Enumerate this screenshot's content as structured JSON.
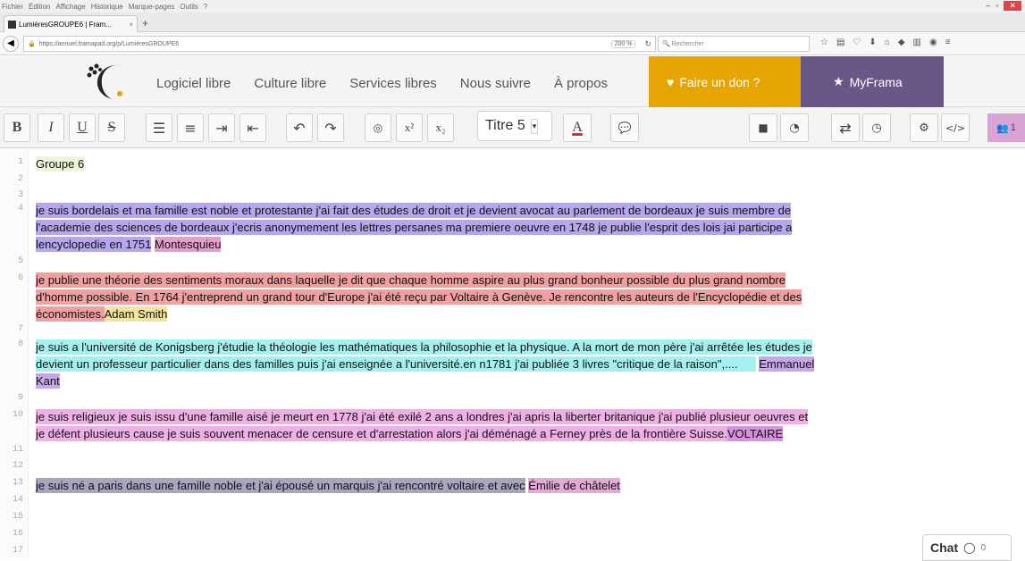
{
  "menubar": {
    "items": [
      "Fichier",
      "Édition",
      "Affichage",
      "Historique",
      "Marque-pages",
      "Outils",
      "?"
    ]
  },
  "tab": {
    "title": "LumièresGROUPE6 | Fram...",
    "close": "×",
    "new": "+"
  },
  "url": {
    "value": "https://annuel.framapad.org/p/LumièresGROUPE6",
    "zoom": "200 %",
    "search_placeholder": "Rechercher"
  },
  "nav": {
    "links": [
      "Logiciel libre",
      "Culture libre",
      "Services libres",
      "Nous suivre",
      "À propos"
    ],
    "don": "Faire un don ?",
    "myframa": "MyFrama"
  },
  "toolbar": {
    "bold": "B",
    "italic": "I",
    "underline": "U",
    "strike": "S",
    "heading": "Titre 5",
    "sup": "x²",
    "sub": "x₂",
    "users_count": "1"
  },
  "colors": {
    "don": "#e6a500",
    "myframa": "#6a5687"
  },
  "doc": {
    "line1": "Groupe 6",
    "p2a": "je suis bordelais et ma famille est noble et protestante j'ai fait des études de droit et je devient avocat au parlement de bordeaux je suis membre de",
    "p2b": "l'academie des sciences de bordeaux j'ecris anonymement les lettres persanes ma premiere oeuvre en 1748 je publie l'esprit des lois jai participe a",
    "p2c": "lencyclopedie en 1751",
    "p2name": "Montesquieu",
    "p3a": "je publie une théorie des sentiments moraux dans laquelle je dit que chaque homme aspire au plus grand bonheur possible du plus grand nombre",
    "p3b": "d'homme possible. En 1764 j'entreprend un grand tour d'Europe j'ai été reçu par Voltaire à Genève. Je rencontre les auteurs de l'Encyclopédie et des",
    "p3c": "économistes.",
    "p3name": "Adam Smith",
    "p4a": "je suis a l'université de Konigsberg j'étudie la théologie les mathématiques la philosophie et la physique. A la mort de mon père j'ai arrêtée les études je",
    "p4b": "devient un professeur particulier dans des familles puis j'ai enseignée a l'université.en n1781 j'ai publiée 3 livres \"critique de la raison\",....",
    "p4name1": "Emmanuel",
    "p4name2": "Kant",
    "p5a": "je suis religieux je suis issu d'une famille aisé je meurt en 1778 j'ai été exilé 2 ans a londres j'ai apris la liberter britanique j'ai publié plusieur oeuvres et",
    "p5b": "je défent plusieurs cause je suis souvent menacer de censure et d'arrestation alors j'ai déménagé a Ferney près de la frontière Suisse.",
    "p5name": "VOLTAIRE",
    "p6a": "je suis né a paris dans une famille noble et j'ai épousé un marquis j'ai rencontré voltaire et avec",
    "p6name": "Émilie de châtelet"
  },
  "line_numbers": [
    "1",
    "2",
    "3",
    "4",
    "5",
    "6",
    "7",
    "8",
    "9",
    "10",
    "11",
    "12",
    "13",
    "14",
    "15",
    "16",
    "17"
  ],
  "chat": {
    "label": "Chat",
    "count": "0"
  }
}
